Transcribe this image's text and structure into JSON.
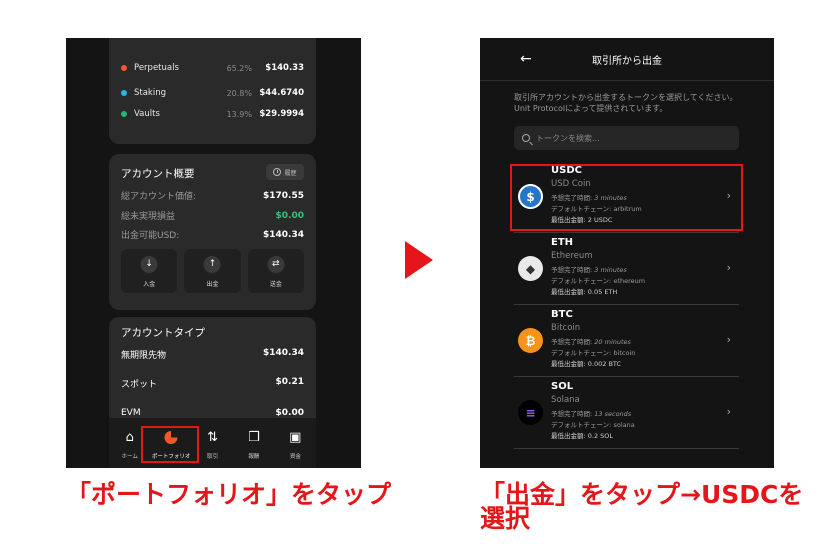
{
  "left": {
    "allocations": [
      {
        "name": "Perpetuals",
        "pct": "65.2%",
        "amount": "$140.33",
        "color": "#f4572c"
      },
      {
        "name": "Staking",
        "pct": "20.8%",
        "amount": "$44.6740",
        "color": "#2bb5e6"
      },
      {
        "name": "Vaults",
        "pct": "13.9%",
        "amount": "$29.9994",
        "color": "#26b37a"
      }
    ],
    "account_summary": {
      "title": "アカウント概要",
      "history_label": "履歴",
      "rows": [
        {
          "label": "総アカウント価値:",
          "value": "$170.55"
        },
        {
          "label": "総未実現損益",
          "value": "$0.00"
        },
        {
          "label": "出金可能USD:",
          "value": "$140.34"
        }
      ],
      "actions": [
        {
          "icon": "↓",
          "label": "入金"
        },
        {
          "icon": "↑",
          "label": "出金"
        },
        {
          "icon": "⇄",
          "label": "送金"
        }
      ]
    },
    "account_type": {
      "title": "アカウントタイプ",
      "rows": [
        {
          "label": "無期限先物",
          "value": "$140.34"
        },
        {
          "label": "スポット",
          "value": "$0.21"
        },
        {
          "label": "EVM",
          "value": "$0.00"
        }
      ]
    },
    "nav": [
      {
        "icon": "home-icon",
        "label": "ホーム"
      },
      {
        "icon": "pie-chart-icon",
        "label": "ポートフォリオ"
      },
      {
        "icon": "trade-arrows-icon",
        "label": "取引"
      },
      {
        "icon": "gift-icon",
        "label": "報酬"
      },
      {
        "icon": "wallet-icon",
        "label": "資金"
      }
    ]
  },
  "right": {
    "title": "取引所から出金",
    "description": "取引所アカウントから出金するトークンを選択してください。Unit Protocolによって提供されています。",
    "search_placeholder": "トークンを検索...",
    "tokens": [
      {
        "symbol": "USDC",
        "name": "USD Coin",
        "time_label": "予想完了時間:",
        "time": "3 minutes",
        "chain_label": "デフォルトチェーン:",
        "chain": "arbitrum",
        "min_label": "最低出金額:",
        "min": "2 USDC",
        "color": "#2775ca",
        "glyph": "$"
      },
      {
        "symbol": "ETH",
        "name": "Ethereum",
        "time_label": "予想完了時間:",
        "time": "3 minutes",
        "chain_label": "デフォルトチェーン:",
        "chain": "ethereum",
        "min_label": "最低出金額:",
        "min": "0.05 ETH",
        "color": "#e9e9e9",
        "glyph": "◆"
      },
      {
        "symbol": "BTC",
        "name": "Bitcoin",
        "time_label": "予想完了時間:",
        "time": "20 minutes",
        "chain_label": "デフォルトチェーン:",
        "chain": "bitcoin",
        "min_label": "最低出金額:",
        "min": "0.002 BTC",
        "color": "#f7931a",
        "glyph": "₿"
      },
      {
        "symbol": "SOL",
        "name": "Solana",
        "time_label": "予想完了時間:",
        "time": "13 seconds",
        "chain_label": "デフォルトチェーン:",
        "chain": "solana",
        "min_label": "最低出金額:",
        "min": "0.2 SOL",
        "color": "#000000",
        "glyph": "≡"
      }
    ]
  },
  "captions": {
    "left": "「ポートフォリオ」をタップ",
    "right": "「出金」をタップ→USDCを選択"
  },
  "accent_color": "#e5161a"
}
